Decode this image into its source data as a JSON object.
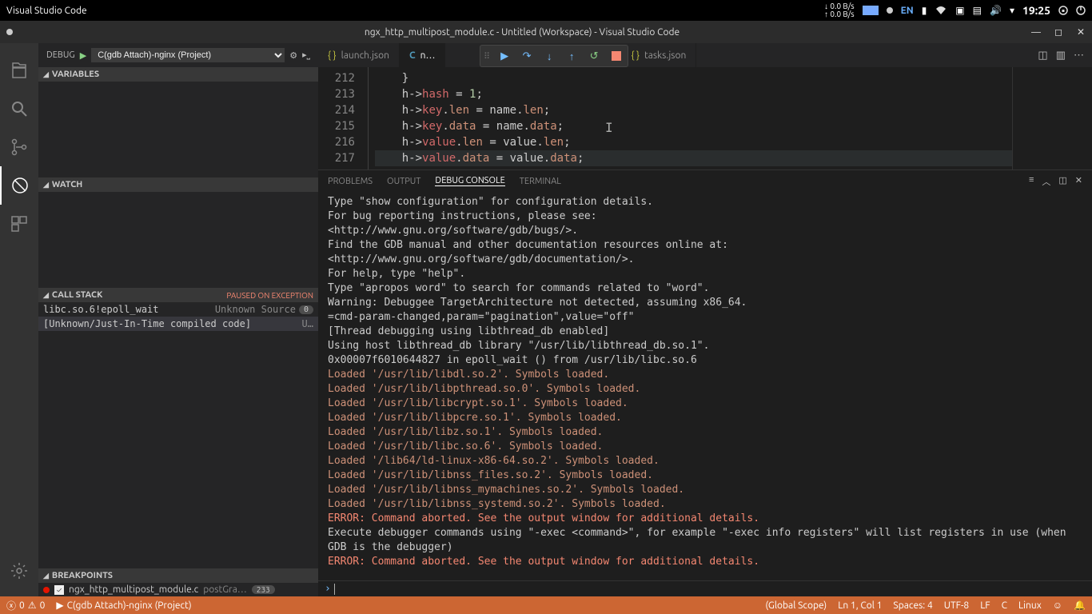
{
  "taskbar": {
    "app_title": "Visual Studio Code",
    "net_down": "0.0 B/s",
    "net_up": "0.0 B/s",
    "lang": "EN",
    "time": "19:25"
  },
  "window": {
    "title": "ngx_http_multipost_module.c - Untitled (Workspace) - Visual Studio Code"
  },
  "debug": {
    "label": "DEBUG",
    "config": "C(gdb Attach)-nginx (Project)"
  },
  "sections": {
    "variables": "VARIABLES",
    "watch": "WATCH",
    "callstack": "CALL STACK",
    "paused": "PAUSED ON EXCEPTION",
    "breakpoints": "BREAKPOINTS"
  },
  "callstack": [
    {
      "fn": "libc.so.6!epoll_wait",
      "src": "Unknown Source",
      "n": "0"
    },
    {
      "fn": "[Unknown/Just-In-Time compiled code]",
      "src": "U…",
      "n": ""
    }
  ],
  "breakpoint": {
    "file": "ngx_http_multipost_module.c",
    "func": "postGra…",
    "line": "233"
  },
  "tabs": {
    "t1": "launch.json",
    "t2": "n…",
    "t3": "tasks.json"
  },
  "code": {
    "lines": [
      "212",
      "213",
      "214",
      "215",
      "216",
      "217"
    ]
  },
  "panel": {
    "problems": "PROBLEMS",
    "output": "OUTPUT",
    "debug": "DEBUG CONSOLE",
    "terminal": "TERMINAL"
  },
  "console_lines": [
    {
      "t": "p",
      "v": "Type \"show configuration\" for configuration details."
    },
    {
      "t": "p",
      "v": "For bug reporting instructions, please see:"
    },
    {
      "t": "p",
      "v": "<http://www.gnu.org/software/gdb/bugs/>."
    },
    {
      "t": "p",
      "v": "Find the GDB manual and other documentation resources online at:"
    },
    {
      "t": "p",
      "v": "<http://www.gnu.org/software/gdb/documentation/>."
    },
    {
      "t": "p",
      "v": "For help, type \"help\"."
    },
    {
      "t": "p",
      "v": "Type \"apropos word\" to search for commands related to \"word\"."
    },
    {
      "t": "p",
      "v": "Warning: Debuggee TargetArchitecture not detected, assuming x86_64."
    },
    {
      "t": "p",
      "v": "=cmd-param-changed,param=\"pagination\",value=\"off\""
    },
    {
      "t": "p",
      "v": "[Thread debugging using libthread_db enabled]"
    },
    {
      "t": "p",
      "v": "Using host libthread_db library \"/usr/lib/libthread_db.so.1\"."
    },
    {
      "t": "p",
      "v": "0x00007f6010644827 in epoll_wait () from /usr/lib/libc.so.6"
    },
    {
      "t": "l",
      "v": "Loaded '/usr/lib/libdl.so.2'. Symbols loaded."
    },
    {
      "t": "l",
      "v": "Loaded '/usr/lib/libpthread.so.0'. Symbols loaded."
    },
    {
      "t": "l",
      "v": "Loaded '/usr/lib/libcrypt.so.1'. Symbols loaded."
    },
    {
      "t": "l",
      "v": "Loaded '/usr/lib/libpcre.so.1'. Symbols loaded."
    },
    {
      "t": "l",
      "v": "Loaded '/usr/lib/libz.so.1'. Symbols loaded."
    },
    {
      "t": "l",
      "v": "Loaded '/usr/lib/libc.so.6'. Symbols loaded."
    },
    {
      "t": "l",
      "v": "Loaded '/lib64/ld-linux-x86-64.so.2'. Symbols loaded."
    },
    {
      "t": "l",
      "v": "Loaded '/usr/lib/libnss_files.so.2'. Symbols loaded."
    },
    {
      "t": "l",
      "v": "Loaded '/usr/lib/libnss_mymachines.so.2'. Symbols loaded."
    },
    {
      "t": "l",
      "v": "Loaded '/usr/lib/libnss_systemd.so.2'. Symbols loaded."
    },
    {
      "t": "e",
      "v": "ERROR: Command aborted. See the output window for additional details."
    },
    {
      "t": "p",
      "v": "Execute debugger commands using \"-exec <command>\", for example \"-exec info registers\" will list registers in use (when GDB is the debugger)"
    },
    {
      "t": "e",
      "v": "ERROR: Command aborted. See the output window for additional details."
    }
  ],
  "status": {
    "errors": "0",
    "warnings": "0",
    "debug": "C(gdb Attach)-nginx (Project)",
    "scope": "(Global Scope)",
    "ln": "Ln 1, Col 1",
    "spaces": "Spaces: 4",
    "enc": "UTF-8",
    "eol": "LF",
    "lang": "C",
    "os": "Linux"
  }
}
